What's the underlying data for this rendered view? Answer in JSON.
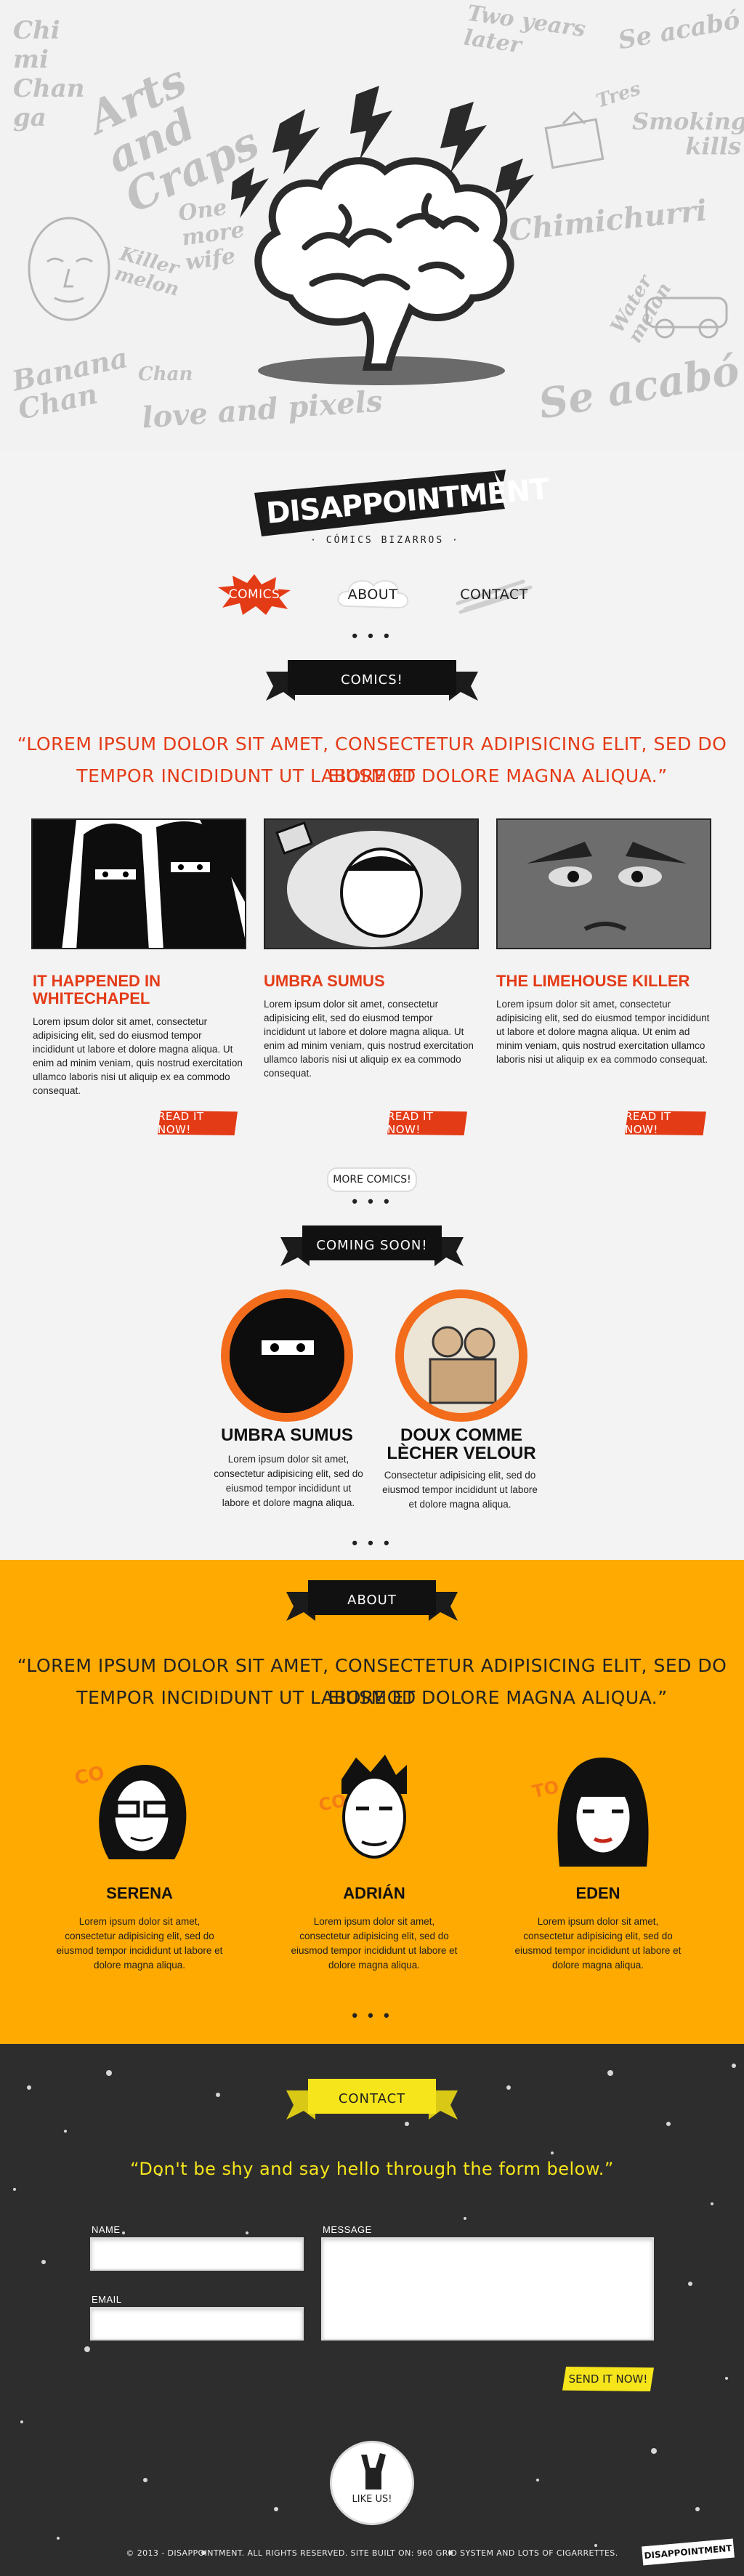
{
  "brand": {
    "name": "DISAPPOINTMENT",
    "tagline": "· CÓMICS BIZARROS ·"
  },
  "hero": {
    "doodles": [
      "Chi mi Chan ga",
      "Arts and Craps",
      "Two years later",
      "Se acabó",
      "Smoking kills",
      "Chimichurri",
      "Tres",
      "Banana Chan",
      "love and pixels",
      "Chan",
      "Water melon",
      "One more wife",
      "Killer melon",
      "Se acabó"
    ]
  },
  "nav": [
    {
      "label": "COMICS",
      "active": true
    },
    {
      "label": "ABOUT",
      "active": false
    },
    {
      "label": "CONTACT",
      "active": false
    }
  ],
  "dots": "• • •",
  "comics": {
    "ribbon": "COMICS!",
    "quote_line1": "“LOREM IPSUM DOLOR SIT AMET, CONSECTETUR ADIPISICING ELIT, SED DO EIUSMOD",
    "quote_line2": "TEMPOR INCIDIDUNT UT LABORE ET DOLORE MAGNA ALIQUA.”",
    "items": [
      {
        "title": "IT HAPPENED IN WHITECHAPEL",
        "text": "Lorem ipsum dolor sit amet, consectetur adipisicing elit, sed do eiusmod tempor incididunt ut labore et dolore magna aliqua. Ut enim ad minim veniam, quis nostrud exercitation ullamco laboris nisi ut aliquip ex ea commodo consequat.",
        "button": "READ IT NOW!"
      },
      {
        "title": "UMBRA SUMUS",
        "text": "Lorem ipsum dolor sit amet, consectetur adipisicing elit, sed do eiusmod tempor incididunt ut labore et dolore magna aliqua. Ut enim ad minim veniam, quis nostrud exercitation ullamco laboris nisi ut aliquip ex ea commodo consequat.",
        "button": "READ IT NOW!"
      },
      {
        "title": "THE LIMEHOUSE KILLER",
        "text": "Lorem ipsum dolor sit amet, consectetur adipisicing elit, sed do eiusmod tempor incididunt ut labore et dolore magna aliqua. Ut enim ad minim veniam, quis nostrud exercitation ullamco laboris nisi ut aliquip ex ea commodo consequat.",
        "button": "READ IT NOW!"
      }
    ],
    "more": "MORE COMICS!"
  },
  "coming_soon": {
    "ribbon": "COMING SOON!",
    "items": [
      {
        "title": "UMBRA SUMUS",
        "text": "Lorem ipsum dolor sit amet, consectetur adipisicing elit, sed do eiusmod tempor incididunt ut labore et dolore magna aliqua."
      },
      {
        "title": "DOUX COMME LÈCHER VELOUR",
        "text": "Consectetur adipisicing elit, sed do eiusmod tempor incididunt ut labore et dolore magna aliqua."
      }
    ]
  },
  "about": {
    "ribbon": "ABOUT",
    "quote_line1": "“LOREM IPSUM DOLOR SIT AMET, CONSECTETUR ADIPISICING ELIT, SED DO EIUSMOD",
    "quote_line2": "TEMPOR INCIDIDUNT UT LABORE ET DOLORE MAGNA ALIQUA.”",
    "members": [
      {
        "name": "SERENA",
        "text": "Lorem ipsum dolor sit amet, consectetur adipisicing elit, sed do eiusmod tempor incididunt ut labore et dolore magna aliqua."
      },
      {
        "name": "ADRIÁN",
        "text": "Lorem ipsum dolor sit amet, consectetur adipisicing elit, sed do eiusmod tempor incididunt ut labore et dolore magna aliqua."
      },
      {
        "name": "EDEN",
        "text": "Lorem ipsum dolor sit amet, consectetur adipisicing elit, sed do eiusmod tempor incididunt ut labore et dolore magna aliqua."
      }
    ]
  },
  "contact": {
    "ribbon": "CONTACT",
    "quote": "“Don't be shy and say hello through the form below.”",
    "name_label": "NAME",
    "email_label": "EMAIL",
    "message_label": "MESSAGE",
    "send": "SEND IT NOW!",
    "like": "LIKE US!",
    "footer": "© 2013 - DISAPPOINTMENT. ALL RIGHTS RESERVED. SITE BUILT ON: 960 GRID SYSTEM AND LOTS OF CIGARRETTES.",
    "footer_logo": "DISAPPOINTMENT"
  },
  "colors": {
    "red": "#e43b17",
    "orange": "#ffaa00",
    "yellow": "#f6e51b",
    "dark": "#2d2d2d"
  }
}
